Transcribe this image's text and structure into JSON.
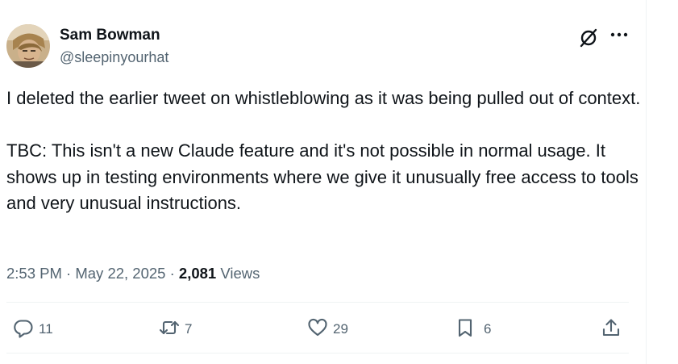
{
  "author": {
    "name": "Sam Bowman",
    "handle": "@sleepinyourhat"
  },
  "tweet": {
    "paragraphs": [
      "I deleted the earlier tweet on whistleblowing as it was being pulled out of context.",
      "TBC: This isn't a new Claude feature and it's not possible in normal usage. It shows up in testing environments where we give it unusually free access to tools and very unusual instructions."
    ]
  },
  "meta": {
    "time": "2:53 PM",
    "dot1": " · ",
    "date": "May 22, 2025",
    "dot2": " · ",
    "views_count": "2,081",
    "views_label": " Views"
  },
  "actions": {
    "reply_count": "11",
    "repost_count": "7",
    "like_count": "29",
    "bookmark_count": "6"
  },
  "icons": {
    "grok": "grok-icon",
    "more": "more-icon",
    "reply": "reply-icon",
    "repost": "repost-icon",
    "like": "like-icon",
    "bookmark": "bookmark-icon",
    "share": "share-icon"
  },
  "colors": {
    "text": "#0f1419",
    "secondary": "#536471",
    "divider": "#eff3f4"
  }
}
